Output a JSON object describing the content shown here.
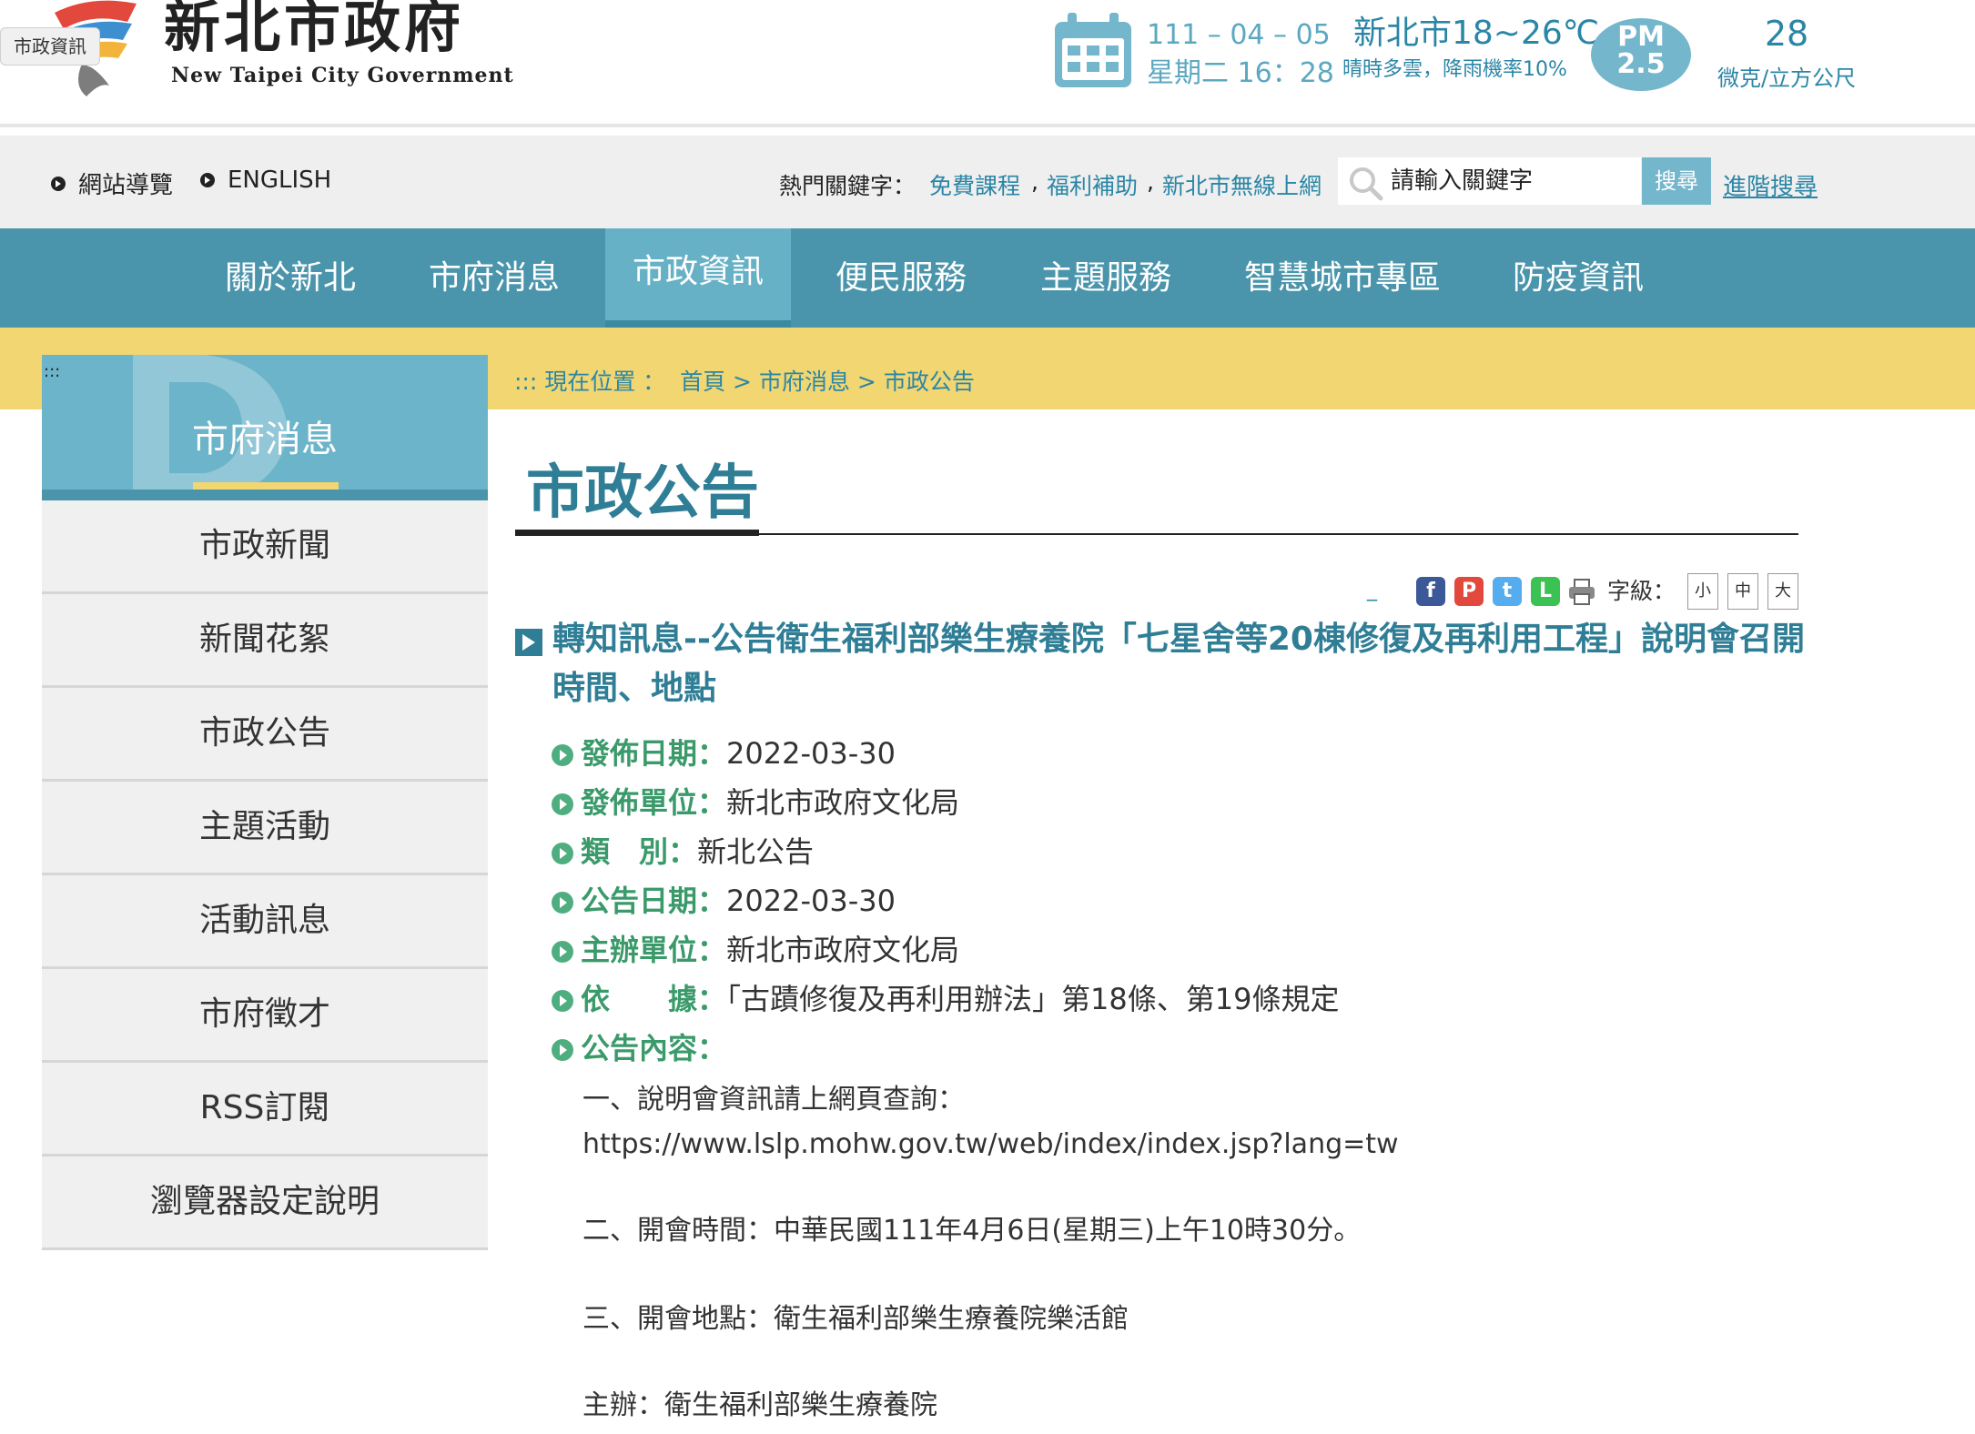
{
  "header": {
    "logo_title": "新北市政府",
    "logo_subtitle": "New Taipei City Government",
    "tag_chip": "市政資訊",
    "date": "111 – 04 – 05",
    "weekday_time": "星期二 16：28",
    "weather_temp": "新北市18~26℃",
    "weather_desc": "晴時多雲，降雨機率10%",
    "pm_label_line1": "PM",
    "pm_label_line2": "2.5",
    "pm_value": "28",
    "pm_unit": "微克/立方公尺"
  },
  "utility": {
    "sitemap": "網站導覽",
    "english": "ENGLISH",
    "hot_keywords_label": "熱門關鍵字：",
    "hot_keywords": [
      "免費課程",
      "福利補助",
      "新北市無線上網"
    ],
    "separator": ",",
    "search_placeholder": "請輸入關鍵字",
    "search_button": "搜尋",
    "advanced_search": "進階搜尋"
  },
  "nav": {
    "items": [
      "關於新北",
      "市府消息",
      "市政資訊",
      "便民服務",
      "主題服務",
      "智慧城市專區",
      "防疫資訊"
    ],
    "active_index": 2
  },
  "breadcrumb": {
    "prefix": "::: 現在位置 ：",
    "items": [
      "首頁",
      "市府消息",
      "市政公告"
    ],
    "sep": ">"
  },
  "sidebar": {
    "dots": ":::",
    "title": "市府消息",
    "items": [
      "市政新聞",
      "新聞花絮",
      "市政公告",
      "主題活動",
      "活動訊息",
      "市府徵才",
      "RSS訂閱",
      "瀏覽器設定說明"
    ]
  },
  "content": {
    "page_title": "市政公告",
    "tools": {
      "dash": "_",
      "font_label": "字級：",
      "font_small": "小",
      "font_medium": "中",
      "font_large": "大"
    },
    "article_title": "轉知訊息--公告衛生福利部樂生療養院「七星舍等20棟修復及再利用工程」說明會召開時間、地點",
    "meta": [
      {
        "label": "發佈日期：",
        "value": "2022-03-30"
      },
      {
        "label": "發佈單位：",
        "value": "新北市政府文化局"
      },
      {
        "label": "類　別：",
        "value": "新北公告"
      },
      {
        "label": "公告日期：",
        "value": "2022-03-30"
      },
      {
        "label": "主辦單位：",
        "value": "新北市政府文化局"
      },
      {
        "label": "依　　據：",
        "value": "「古蹟修復及再利用辦法」第18條、第19條規定"
      },
      {
        "label": "公告內容：",
        "value": ""
      }
    ],
    "body": [
      "一、說明會資訊請上網頁查詢：",
      "https://www.lslp.mohw.gov.tw/web/index/index.jsp?lang=tw",
      "二、開會時間：中華民國111年4月6日(星期三)上午10時30分。",
      "三、開會地點：衛生福利部樂生療養院樂活館",
      "主辦：衛生福利部樂生療養院"
    ]
  },
  "colors": {
    "teal": "#4a95ab",
    "teal_light": "#6cb4c9",
    "yellow": "#f1d671",
    "link": "#2b86a6",
    "green": "#3a9a6a"
  }
}
